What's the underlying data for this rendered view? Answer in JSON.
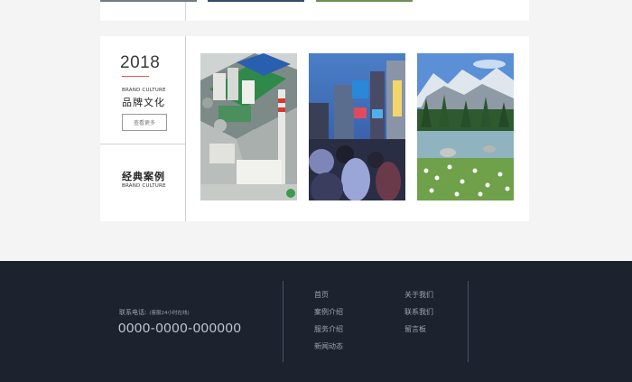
{
  "brand_section": {
    "year": "2018",
    "subtitle_en": "BRAND CULTURE",
    "title_cn": "品牌文化",
    "more_button": "查看更多",
    "accent_color": "#e8525a"
  },
  "case_section": {
    "title_cn": "经典案例",
    "subtitle_en": "BRAND CULTURE"
  },
  "gallery": [
    {
      "icon": "industrial-plant-photo"
    },
    {
      "icon": "city-crowd-photo"
    },
    {
      "icon": "mountain-lake-photo"
    }
  ],
  "footer": {
    "phone_label": "联系电话:",
    "phone_note": "(客服24小时在线)",
    "phone_number": "0000-0000-000000",
    "links_left": [
      "首页",
      "案例介绍",
      "服务介绍",
      "新闻动态"
    ],
    "links_right": [
      "关于我们",
      "联系我们",
      "留言板"
    ],
    "background": "#1d222f"
  }
}
